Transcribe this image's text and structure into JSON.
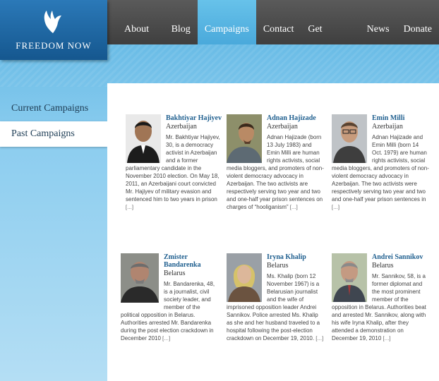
{
  "site": {
    "logo_text": "FREEDOM NOW"
  },
  "nav": {
    "items": [
      {
        "label": "About Us",
        "active": false
      },
      {
        "label": "Blog",
        "active": false
      },
      {
        "label": "Campaigns",
        "active": true
      },
      {
        "label": "Contact",
        "active": false
      },
      {
        "label": "Get Involved",
        "active": false
      },
      {
        "label": "News",
        "active": false
      },
      {
        "label": "Donate",
        "active": false
      }
    ]
  },
  "sidebar": {
    "current_campaigns": "Current Campaigns",
    "past_campaigns": "Past Campaigns"
  },
  "campaigns": [
    {
      "name": "Bakhtiyar Hajiyev",
      "country": "Azerbaijan",
      "bio": "Mr. Bakhtiyar Hajiyev, 30, is a democracy activist in Azerbaijan and a former parliamentary candidate in the November 2010 election. On May 18, 2011, an Azerbaijani court convicted Mr. Hajiyev of military evasion and sentenced him to two years in prison",
      "more": "[…]"
    },
    {
      "name": "Adnan Hajizade",
      "country": "Azerbaijan",
      "bio": "Adnan Hajizade (born 13 July 1983) and Emin Milli are human rights activists, social media bloggers, and promoters of non-violent democracy advocacy in Azerbaijan. The two activists are respectively serving two year and two and one-half year prison sentences on charges of “hooliganism”",
      "more": "[…]"
    },
    {
      "name": "Emin Milli",
      "country": "Azerbaijan",
      "bio": "Adnan Hajizade and Emin Milli (born 14 Oct. 1979) are human rights activists, social media bloggers, and promoters of non-violent democracy advocacy in Azerbaijan. The two activists were respectively serving two year and two and one-half year prison sentences in",
      "more": "[…]"
    },
    {
      "name": "Zmister Bandarenka",
      "country": "Belarus",
      "bio": "Mr. Bandarenka, 48, is a journalist, civil society leader, and member of the political opposition in Belarus. Authorities arrested Mr. Bandarenka during the post election crackdown in December 2010",
      "more": "[…]"
    },
    {
      "name": "Iryna Khalip",
      "country": "Belarus",
      "bio": "Ms. Khalip (born 12 November 1967) is a Belarusian journalist and the wife of imprisoned opposition leader Andrei Sannikov. Police arrested Ms. Khalip as she and her husband traveled to a hospital following the post-election crackdown on December 19, 2010.",
      "more": "[…]"
    },
    {
      "name": "Andrei Sannikov",
      "country": "Belarus",
      "bio": "Mr. Sannikov, 58, is a former diplomat and the most prominent member of the opposition in Belarus. Authorities beat and arrested Mr. Sannikov, along with his wife Iryna Khalip, after they attended a demonstration on December 19, 2010",
      "more": "[…]"
    }
  ]
}
